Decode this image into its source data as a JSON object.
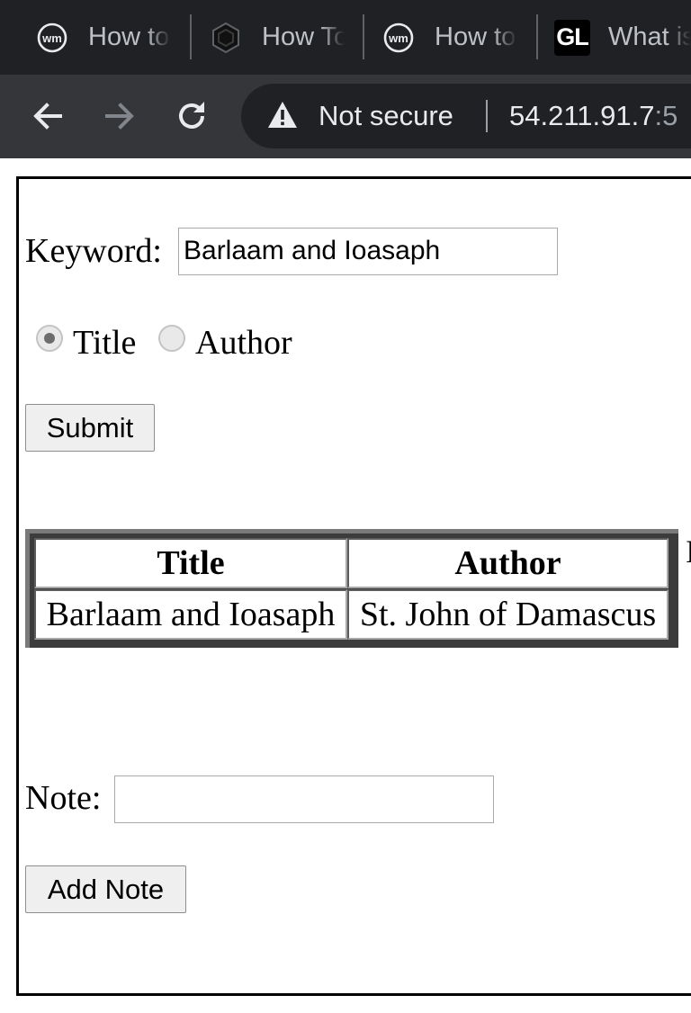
{
  "browser": {
    "tabs": [
      {
        "title": "How to",
        "icon": "wm-logo-icon"
      },
      {
        "title": "How To",
        "icon": "hexagon-logo-icon"
      },
      {
        "title": "How to",
        "icon": "wm-logo-icon"
      },
      {
        "title": "What is",
        "icon": "gl-logo-icon",
        "icon_text": "GL"
      }
    ],
    "security_label": "Not secure",
    "url": "54.211.91.7",
    "url_dim": ":5"
  },
  "form": {
    "keyword_label": "Keyword:",
    "keyword_value": "Barlaam and Ioasaph",
    "search_by": {
      "options": [
        "Title",
        "Author"
      ],
      "selected": "Title"
    },
    "submit_label": "Submit"
  },
  "results": {
    "headers": [
      "Title",
      "Author"
    ],
    "rows": [
      [
        "Barlaam and Ioasaph",
        "St. John of Damascus"
      ]
    ],
    "edge_text": "I"
  },
  "note": {
    "label": "Note:",
    "value": "",
    "button_label": "Add Note"
  },
  "colors": {
    "tab_bar_bg": "#202124",
    "toolbar_bg": "#35363a",
    "table_frame": "#3c3c3c"
  }
}
